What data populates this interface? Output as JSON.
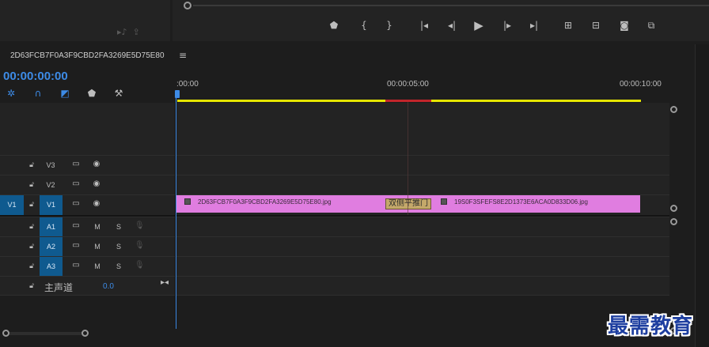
{
  "sequence": {
    "name": "2D63FCB7F0A3F9CBD2FA3269E5D75E80",
    "menu_icon": "hamburger-menu-icon",
    "timecode": "00:00:00:00"
  },
  "transport": {
    "buttons": [
      "add-marker-icon",
      "mark-in-icon",
      "mark-out-icon",
      "go-to-in-icon",
      "step-back-icon",
      "play-icon",
      "step-forward-icon",
      "go-to-out-icon",
      "lift-icon",
      "extract-icon",
      "export-frame-icon",
      "button-editor-icon"
    ]
  },
  "tools": [
    "snap-nest-icon",
    "snap-icon",
    "linked-selection-icon",
    "add-marker-icon",
    "settings-wrench-icon"
  ],
  "ruler": {
    "labels": [
      ":00:00",
      "00:00:05:00",
      "00:00:10:00"
    ]
  },
  "tracks": {
    "video": [
      {
        "source": "",
        "name": "V3"
      },
      {
        "source": "",
        "name": "V2"
      },
      {
        "source": "V1",
        "name": "V1"
      }
    ],
    "audio": [
      {
        "name": "A1",
        "m": "M",
        "s": "S"
      },
      {
        "name": "A2",
        "m": "M",
        "s": "S"
      },
      {
        "name": "A3",
        "m": "M",
        "s": "S"
      }
    ],
    "master": {
      "name": "主声道",
      "value": "0.0"
    }
  },
  "clips": {
    "clip1": "2D63FCB7F0A3F9CBD2FA3269E5D75E80.jpg",
    "clip2": "19S0F3SFEFS8E2D1373E6ACA0D833D06.jpg",
    "transition": "双侧平推门"
  },
  "watermark": "最需教育",
  "colors": {
    "accent_blue": "#3d8be6",
    "clip_pink": "#e07de0",
    "work_area_yellow": "#e5e500",
    "render_red": "#c2252b",
    "track_target_blue": "#0f5a8f"
  }
}
